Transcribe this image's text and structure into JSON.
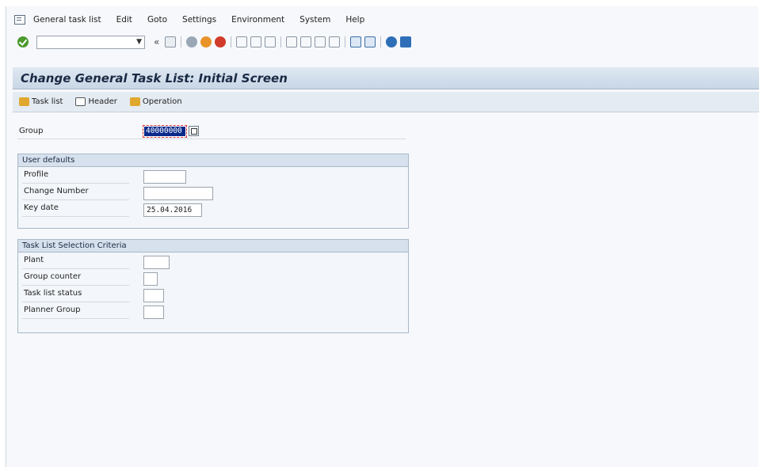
{
  "menu": [
    "General task list",
    "Edit",
    "Goto",
    "Settings",
    "Environment",
    "System",
    "Help"
  ],
  "toolbar": {
    "command_value": ""
  },
  "title": "Change General Task List: Initial Screen",
  "app_toolbar": {
    "task_list": "Task list",
    "header": "Header",
    "operation": "Operation"
  },
  "group": {
    "label": "Group",
    "value": "40000000"
  },
  "user_defaults": {
    "title": "User defaults",
    "profile": {
      "label": "Profile",
      "value": ""
    },
    "change_number": {
      "label": "Change Number",
      "value": ""
    },
    "key_date": {
      "label": "Key date",
      "value": "25.04.2016"
    }
  },
  "selection": {
    "title": "Task List Selection Criteria",
    "plant": {
      "label": "Plant",
      "value": ""
    },
    "group_counter": {
      "label": "Group counter",
      "value": ""
    },
    "task_list_status": {
      "label": "Task list status",
      "value": ""
    },
    "planner_group": {
      "label": "Planner Group",
      "value": ""
    }
  },
  "colors": {
    "ok_green": "#4a9a2e",
    "selection_blue": "#0a2a8c",
    "title_text": "#1a2a44"
  }
}
